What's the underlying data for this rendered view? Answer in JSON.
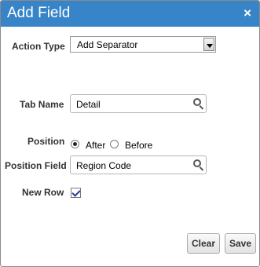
{
  "dialog": {
    "title": "Add Field",
    "close_glyph": "×"
  },
  "form": {
    "action_type": {
      "label": "Action Type",
      "value": "Add Separator"
    },
    "tab_name": {
      "label": "Tab Name",
      "value": "Detail"
    },
    "position": {
      "label": "Position",
      "options": [
        "After",
        "Before"
      ],
      "selected": "After"
    },
    "position_field": {
      "label": "Position Field",
      "value": "Region Code"
    },
    "new_row": {
      "label": "New Row",
      "checked": true
    }
  },
  "buttons": {
    "clear": "Clear",
    "save": "Save"
  },
  "colors": {
    "titlebar": "#3784c8"
  },
  "icons": [
    "close-icon",
    "search-icon",
    "dropdown-arrow-icon"
  ]
}
